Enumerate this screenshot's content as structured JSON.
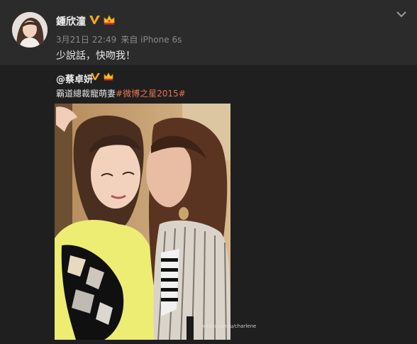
{
  "post": {
    "username": "鍾欣潼",
    "time": "3月21日 22:49",
    "source": "来自 iPhone 6s",
    "text": "少說話，快吻我！"
  },
  "repost": {
    "username": "@蔡卓妍",
    "text": "霸道總裁寵萌妻",
    "hashtag": "#微博之星2015#",
    "watermark": "weibo.com/u/charlene"
  },
  "icons": {
    "verified": "verified-v-icon",
    "crown": "crown-icon",
    "expand": "chevron-down-icon"
  },
  "colors": {
    "background": "#2b2b2b",
    "repost_background": "#1f1f1f",
    "hashtag": "#eb7350",
    "verified": "#f5a623"
  }
}
